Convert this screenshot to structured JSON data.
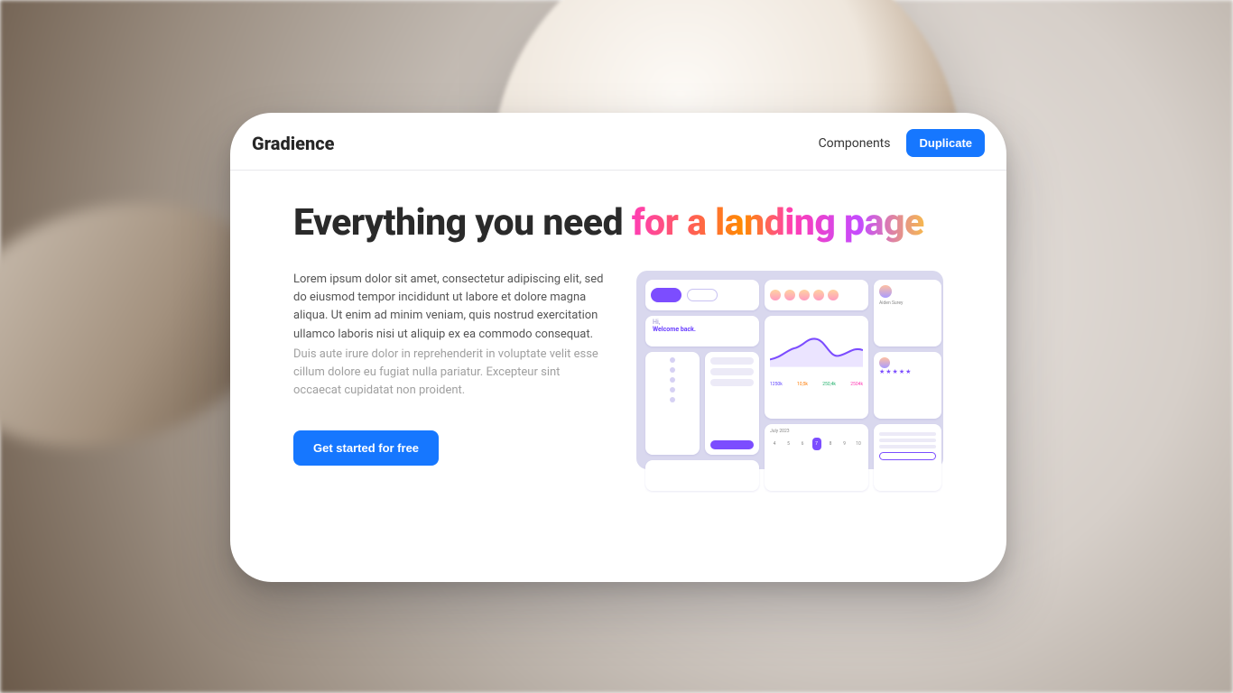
{
  "header": {
    "brand": "Gradience",
    "nav_components": "Components",
    "duplicate_label": "Duplicate"
  },
  "hero": {
    "title_plain": "Everything you need ",
    "title_gradient": "for a landing page"
  },
  "copy": {
    "p1": "Lorem ipsum dolor sit amet, consectetur adipiscing elit, sed do eiusmod tempor incididunt ut labore et dolore magna aliqua. Ut enim ad minim veniam, quis nostrud exercitation ullamco laboris nisi ut aliquip ex ea commodo consequat.",
    "p2": "Duis aute irure dolor in reprehenderit in voluptate velit esse cillum dolore eu fugiat nulla pariatur. Excepteur sint occaecat cupidatat non proident."
  },
  "cta": {
    "label": "Get started for free"
  },
  "mock": {
    "hello_small": "Hi,",
    "hello_big": "Welcome back.",
    "profile_name": "Aiden Surey",
    "chart_vals": [
      "1250k",
      "10,5k",
      "250,4k",
      "2504k"
    ],
    "cal_title": "July 2023",
    "cal_days": [
      "4",
      "5",
      "6",
      "7",
      "8",
      "9",
      "10"
    ]
  }
}
